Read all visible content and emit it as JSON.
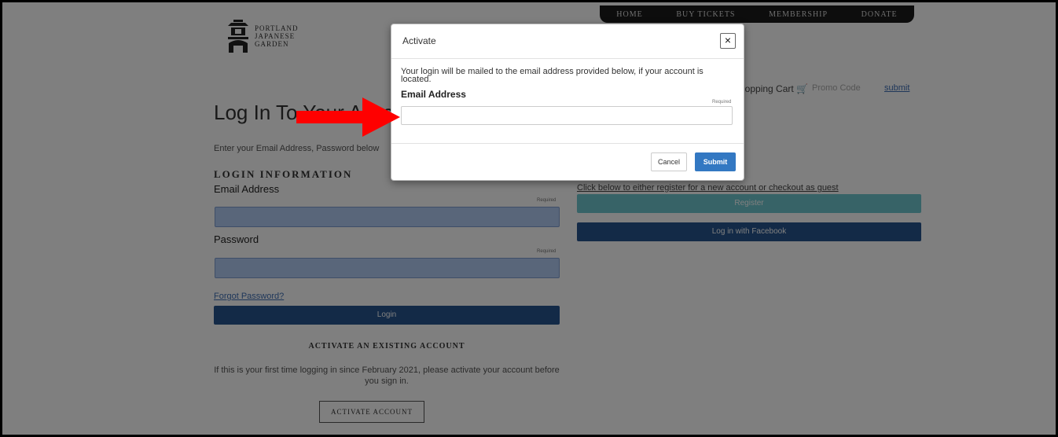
{
  "nav": [
    "HOME",
    "BUY TICKETS",
    "MEMBERSHIP",
    "DONATE"
  ],
  "logo": {
    "line1": "PORTLAND",
    "line2": "JAPANESE",
    "line3": "GARDEN"
  },
  "login": {
    "title": "Log In To Your Account",
    "intro": "Enter your Email Address, Password below",
    "section_heading": "LOGIN INFORMATION",
    "email_label": "Email Address",
    "password_label": "Password",
    "required": "Required",
    "forgot_link": "Forgot Password?",
    "login_button": "Login"
  },
  "activate": {
    "heading": "ACTIVATE AN EXISTING ACCOUNT",
    "text": "If this is your first time logging in since February 2021, please activate your account before you sign in.",
    "button": "ACTIVATE ACCOUNT"
  },
  "right": {
    "cart": "Shopping Cart",
    "promo": "Promo Code",
    "submit_link": "submit",
    "click_below": "Click below to either register for a new account or checkout as guest",
    "register_button": "Register",
    "facebook_button": "Log in with Facebook"
  },
  "modal": {
    "title": "Activate",
    "close": "×",
    "description": "Your login will be mailed to the email address provided below, if your account is located.",
    "email_label": "Email Address",
    "required": "Required",
    "email_value": "",
    "cancel": "Cancel",
    "submit": "Submit"
  },
  "colors": {
    "overlay": "#808080",
    "primary": "#26558f",
    "accent": "#6fc7cf",
    "submit": "#3378c2",
    "arrow": "#ff0000"
  }
}
